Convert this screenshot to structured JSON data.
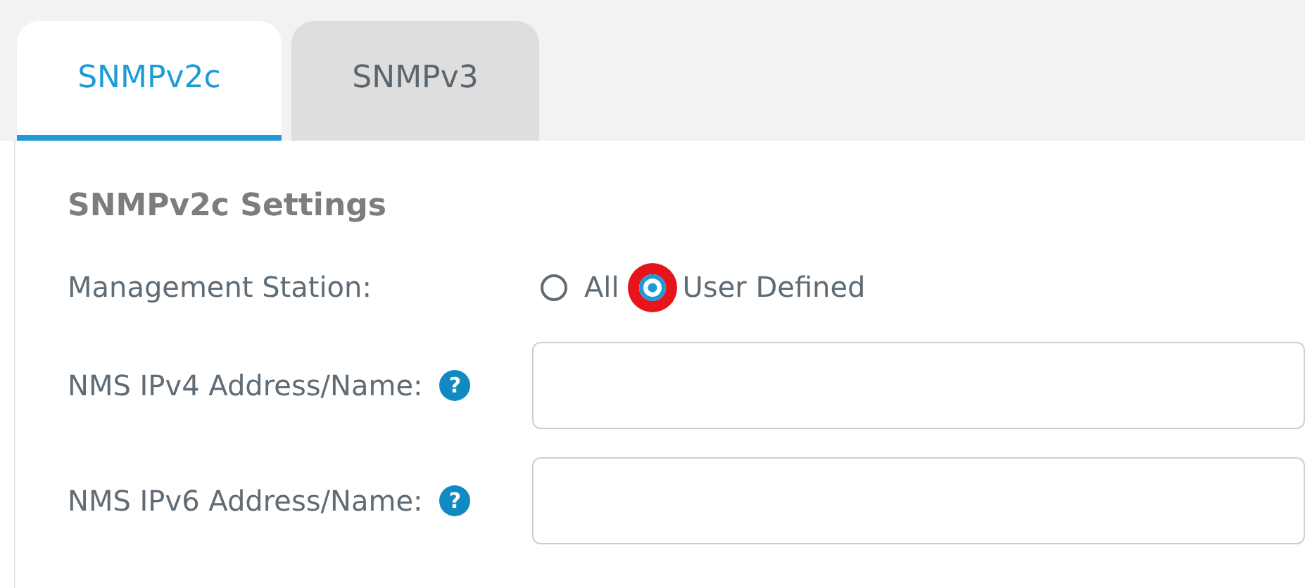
{
  "tabs": [
    {
      "label": "SNMPv2c",
      "selected": true
    },
    {
      "label": "SNMPv3",
      "selected": false
    }
  ],
  "section_title": "SNMPv2c Settings",
  "management_station": {
    "label": "Management Station:",
    "options": [
      {
        "label": "All",
        "selected": false,
        "highlighted": false
      },
      {
        "label": "User Defined",
        "selected": true,
        "highlighted": true
      }
    ]
  },
  "fields": [
    {
      "label": "NMS IPv4 Address/Name:",
      "help": "?"
    },
    {
      "label": "NMS IPv6 Address/Name:",
      "help": "?"
    }
  ]
}
